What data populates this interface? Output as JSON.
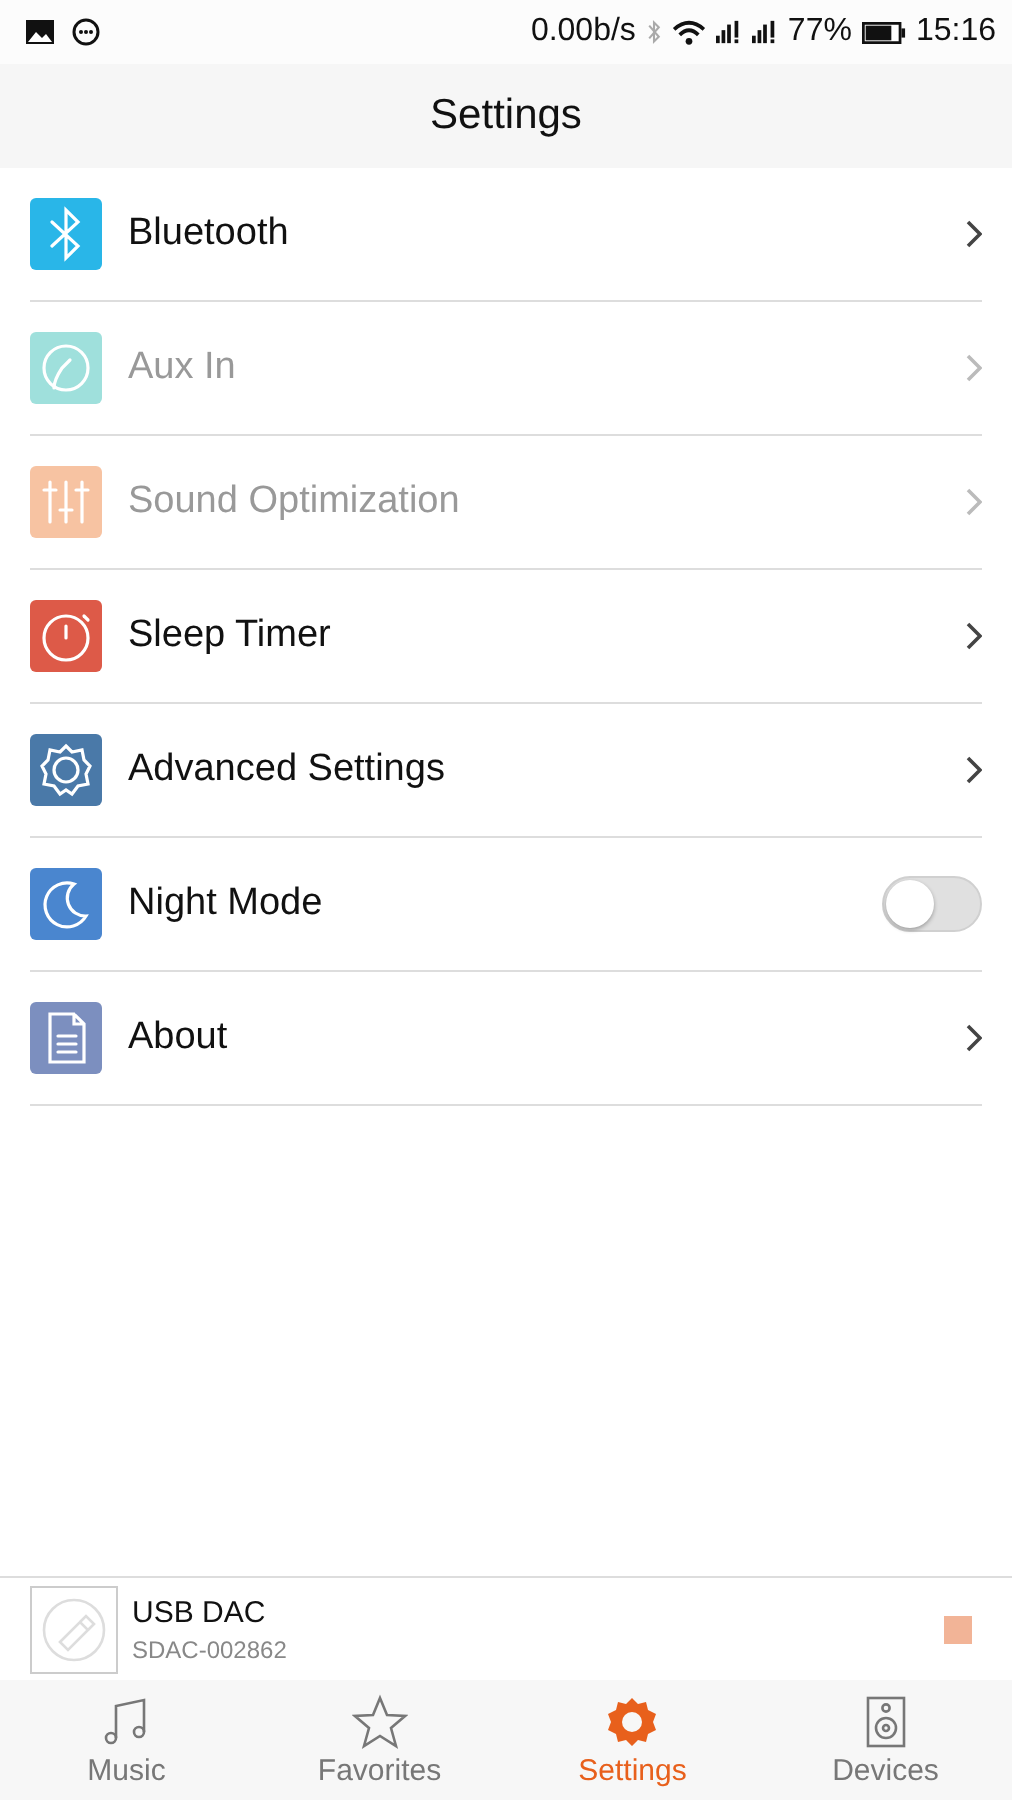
{
  "status_bar": {
    "speed": "0.00b/s",
    "battery_text": "77%",
    "time": "15:16"
  },
  "header": {
    "title": "Settings"
  },
  "items": [
    {
      "label": "Bluetooth",
      "kind": "link",
      "disabled": false,
      "color": "#29b6e8"
    },
    {
      "label": "Aux In",
      "kind": "link",
      "disabled": true,
      "color": "#9fe0dc"
    },
    {
      "label": "Sound Optimization",
      "kind": "link",
      "disabled": true,
      "color": "#f7c3a2"
    },
    {
      "label": "Sleep Timer",
      "kind": "link",
      "disabled": false,
      "color": "#dd5a48"
    },
    {
      "label": "Advanced Settings",
      "kind": "link",
      "disabled": false,
      "color": "#4a79a8"
    },
    {
      "label": "Night Mode",
      "kind": "toggle",
      "disabled": false,
      "on": false,
      "color": "#4a86cf"
    },
    {
      "label": "About",
      "kind": "link",
      "disabled": false,
      "color": "#7c8fbf"
    }
  ],
  "now_playing": {
    "title": "USB DAC",
    "subtitle": "SDAC-002862"
  },
  "tabs": [
    {
      "label": "Music",
      "selected": false
    },
    {
      "label": "Favorites",
      "selected": false
    },
    {
      "label": "Settings",
      "selected": true
    },
    {
      "label": "Devices",
      "selected": false
    }
  ]
}
